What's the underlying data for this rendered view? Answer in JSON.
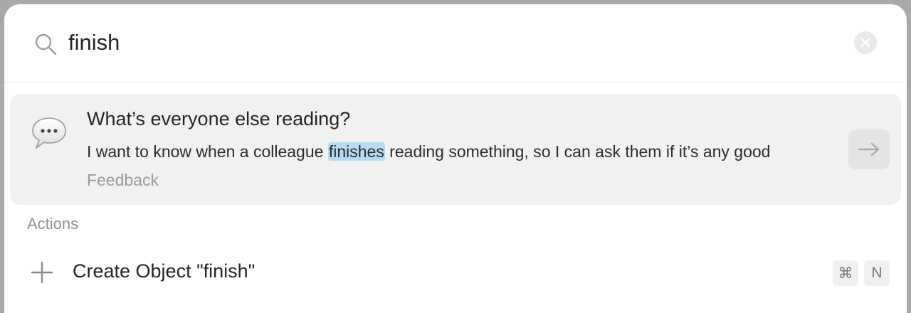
{
  "search": {
    "value": "finish",
    "icon": "search-icon",
    "clear_icon": "close-icon"
  },
  "result": {
    "icon": "speech-bubble-icon",
    "title": "What’s everyone else reading?",
    "body_before": "I want to know when a colleague ",
    "body_match": "finishes",
    "body_after": " reading something, so I can ask them if it’s any good",
    "type": "Feedback",
    "open_icon": "arrow-right-icon"
  },
  "actions": {
    "section_label": "Actions",
    "items": [
      {
        "icon": "plus-icon",
        "label": "Create Object \"finish\"",
        "shortcut": [
          "⌘",
          "N"
        ]
      }
    ]
  },
  "colors": {
    "highlight": "#b5dcf6",
    "card_bg": "#f1f1f1",
    "muted_text": "#9a9a9a"
  }
}
